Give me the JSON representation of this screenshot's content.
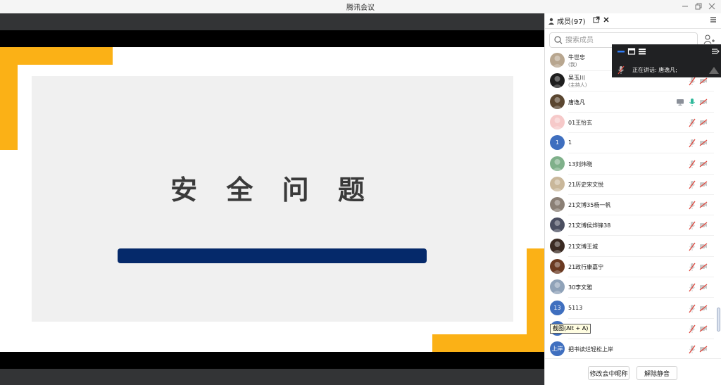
{
  "window": {
    "title": "腾讯会议"
  },
  "slide": {
    "title": "安 全 问 题"
  },
  "members_panel": {
    "tab_label": "成员(97)",
    "search_placeholder": "搜索成员",
    "members": [
      {
        "name": "牛世忠",
        "role": "(我)",
        "avatar": "photo",
        "avatar_color": "#b8a68f",
        "avatar_text": ""
      },
      {
        "name": "吴玉川",
        "role": "(主持人)",
        "avatar": "photo",
        "avatar_color": "#1e1e1e",
        "avatar_text": ""
      },
      {
        "name": "唐逸凡",
        "role": "",
        "avatar": "photo",
        "avatar_color": "#5a4630",
        "avatar_text": "",
        "sharing": true,
        "mic_on": true
      },
      {
        "name": "01王怡玄",
        "role": "",
        "avatar": "photo",
        "avatar_color": "#f6c9c9",
        "avatar_text": ""
      },
      {
        "name": "1",
        "role": "",
        "avatar": "initial",
        "avatar_color": "#3f6fbf",
        "avatar_text": "1"
      },
      {
        "name": "13刘炜晓",
        "role": "",
        "avatar": "photo",
        "avatar_color": "#7fb08a",
        "avatar_text": ""
      },
      {
        "name": "21历史宋文悦",
        "role": "",
        "avatar": "photo",
        "avatar_color": "#c9b79a",
        "avatar_text": ""
      },
      {
        "name": "21文博35杨一帆",
        "role": "",
        "avatar": "photo",
        "avatar_color": "#8a7f75",
        "avatar_text": ""
      },
      {
        "name": "21文博侯烨锋38",
        "role": "",
        "avatar": "photo",
        "avatar_color": "#4a4e60",
        "avatar_text": ""
      },
      {
        "name": "21文博王城",
        "role": "",
        "avatar": "photo",
        "avatar_color": "#3a2a22",
        "avatar_text": ""
      },
      {
        "name": "21政行康嘉宁",
        "role": "",
        "avatar": "photo",
        "avatar_color": "#6b3a22",
        "avatar_text": ""
      },
      {
        "name": "30李文雅",
        "role": "",
        "avatar": "photo",
        "avatar_color": "#8fa2b8",
        "avatar_text": ""
      },
      {
        "name": "5113",
        "role": "",
        "avatar": "initial",
        "avatar_color": "#3f6fbf",
        "avatar_text": "13"
      },
      {
        "name": "",
        "role": "",
        "avatar": "initial",
        "avatar_color": "#3f6fbf",
        "avatar_text": ""
      },
      {
        "name": "把书读烂轻松上岸",
        "role": "",
        "avatar": "initial",
        "avatar_color": "#3f6fbf",
        "avatar_text": "上岸"
      }
    ],
    "tooltip": "截图(Alt + A)",
    "footer": {
      "rename_label": "修改会中昵称",
      "unmute_label": "解除静音"
    }
  },
  "floating_bar": {
    "speaking": "正在讲话:  唐逸凡;"
  },
  "colors": {
    "accent_yellow": "#fbb116",
    "slide_bar": "#05296a",
    "mic_on": "#2fb89a",
    "mic_off": "#e0463c"
  }
}
